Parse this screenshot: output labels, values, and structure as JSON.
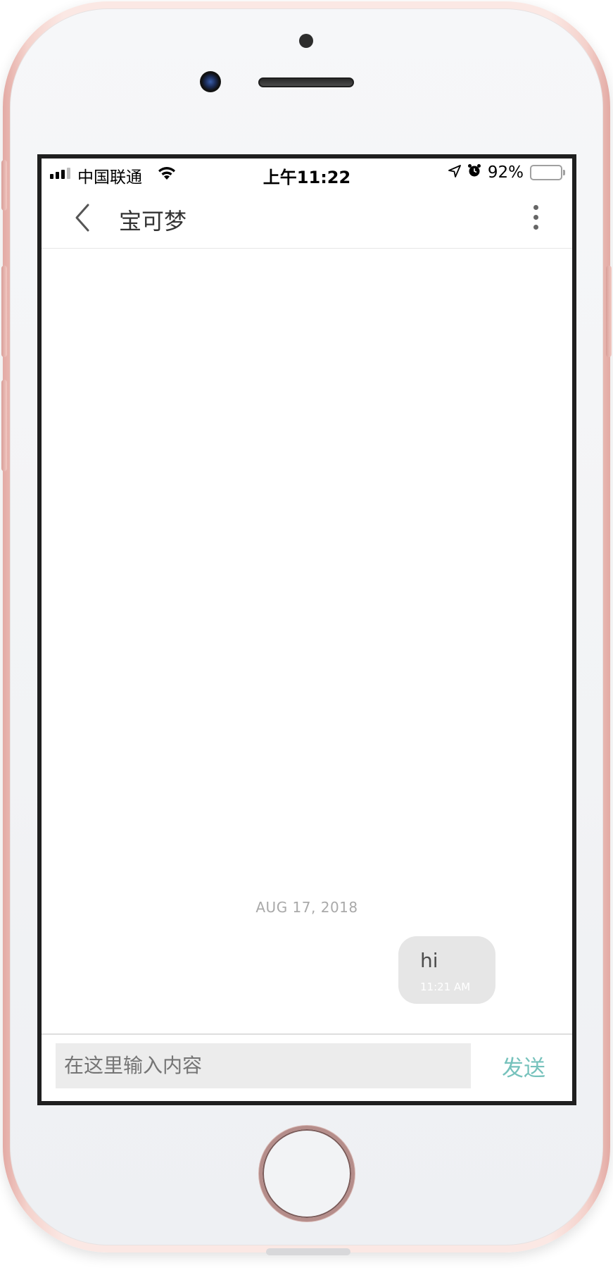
{
  "status_bar": {
    "carrier": "中国联通",
    "time": "上午11:22",
    "battery_percent": "92%",
    "battery_level": 0.92,
    "battery_color": "#f7c63b",
    "icons": [
      "signal-icon",
      "wifi-icon",
      "location-arrow-icon",
      "alarm-icon",
      "battery-icon"
    ]
  },
  "nav": {
    "title": "宝可梦",
    "back_icon": "chevron-left-icon",
    "more_icon": "more-vertical-icon"
  },
  "conversation": {
    "date_separator": "AUG 17, 2018",
    "messages": [
      {
        "text": "hi",
        "time": "11:21 AM",
        "outgoing": true
      }
    ]
  },
  "composer": {
    "placeholder": "在这里输入内容",
    "send_label": "发送",
    "accent_color": "#76c2bc"
  },
  "device": {
    "color": "rose-gold"
  }
}
